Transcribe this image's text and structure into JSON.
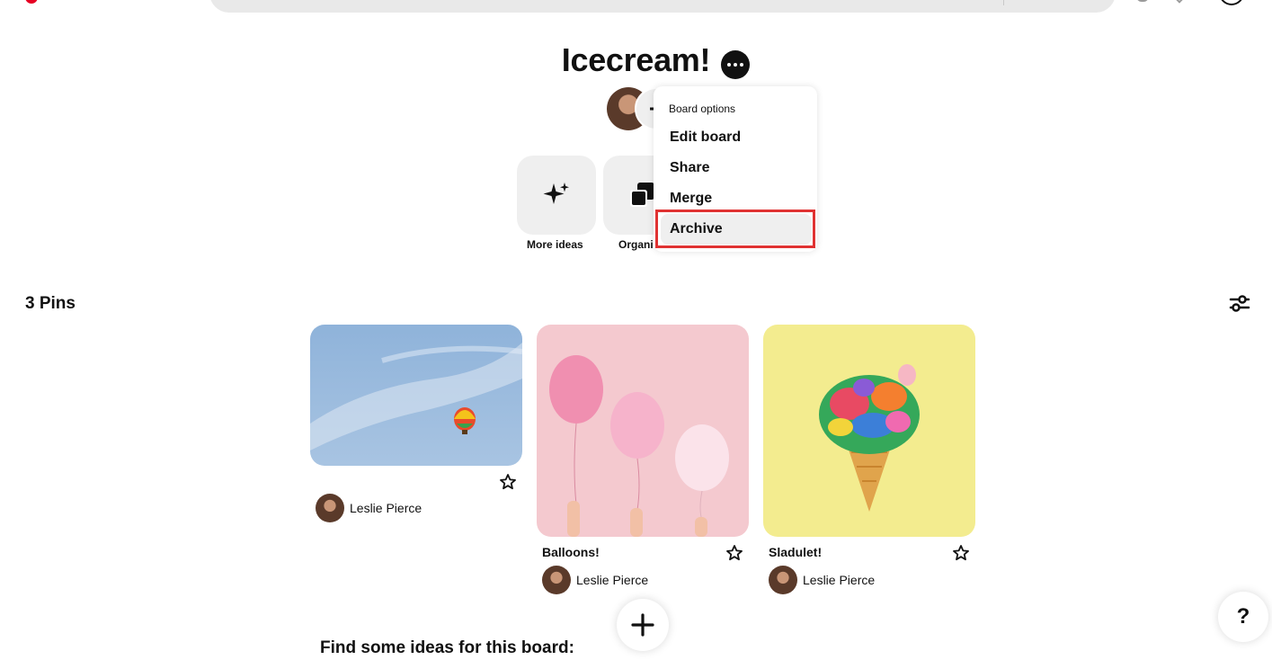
{
  "board": {
    "title": "Icecream!",
    "more_icon": "ellipsis-icon",
    "add_collaborator_label": "+"
  },
  "actions": [
    {
      "label": "More ideas",
      "icon": "sparkle-icon"
    },
    {
      "label": "Organi",
      "icon": "organize-icon"
    }
  ],
  "board_options_menu": {
    "heading": "Board options",
    "items": [
      "Edit board",
      "Share",
      "Merge",
      "Archive"
    ],
    "highlighted_item": "Archive",
    "highlight_color": "#e03232"
  },
  "pins": {
    "count_label": "3 Pins",
    "filter_icon": "filter-icon",
    "items": [
      {
        "title": "",
        "owner": "Leslie Pierce",
        "image": "hot-air-balloon-sky"
      },
      {
        "title": "Balloons!",
        "owner": "Leslie Pierce",
        "image": "pink-balloons"
      },
      {
        "title": "Sladulet!",
        "owner": "Leslie Pierce",
        "image": "confetti-cone"
      }
    ]
  },
  "ideas_heading": "Find some ideas for this board:",
  "help_label": "?",
  "colors": {
    "brand": "#e60023",
    "tile_bg": "#efefef"
  }
}
